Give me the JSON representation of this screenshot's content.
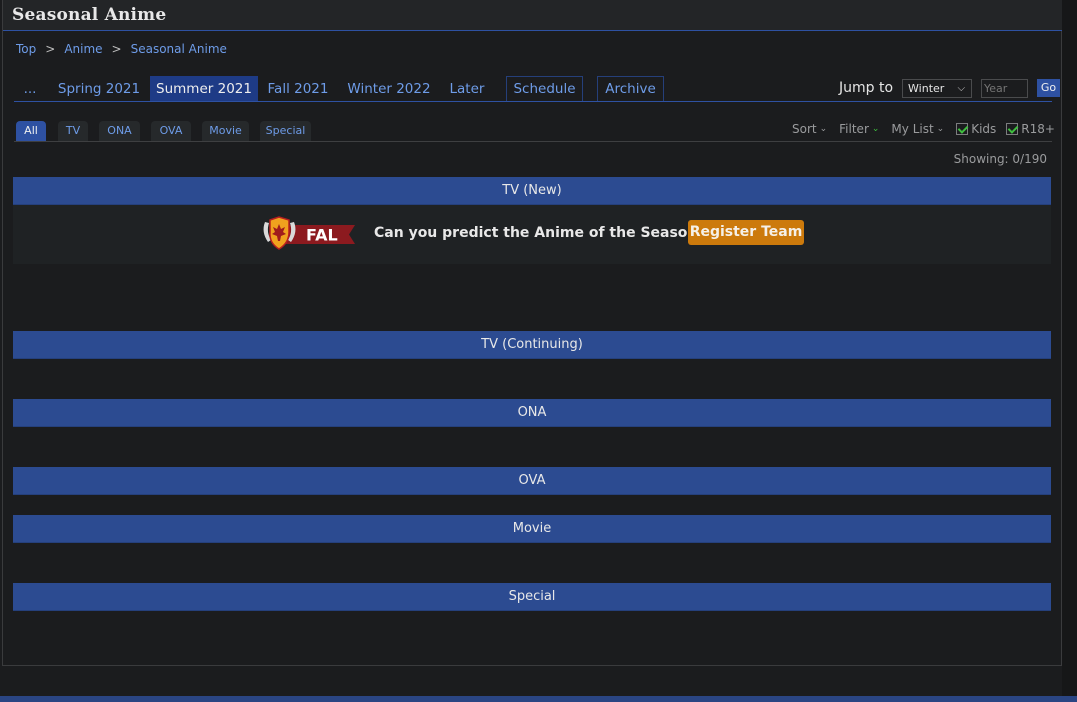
{
  "header": {
    "title": "Seasonal Anime"
  },
  "breadcrumb": {
    "items": [
      "Top",
      "Anime",
      "Seasonal Anime"
    ],
    "separator": ">"
  },
  "season_tabs": [
    {
      "label": "...",
      "active": false
    },
    {
      "label": "Spring 2021",
      "active": false
    },
    {
      "label": "Summer 2021",
      "active": true
    },
    {
      "label": "Fall 2021",
      "active": false
    },
    {
      "label": "Winter 2022",
      "active": false
    },
    {
      "label": "Later",
      "active": false
    },
    {
      "label": "Schedule",
      "active": false
    },
    {
      "label": "Archive",
      "active": false
    }
  ],
  "jump": {
    "label": "Jump to",
    "season_selected": "Winter",
    "year_placeholder": "Year",
    "go_label": "Go"
  },
  "type_tabs": [
    {
      "label": "All",
      "active": true
    },
    {
      "label": "TV",
      "active": false
    },
    {
      "label": "ONA",
      "active": false
    },
    {
      "label": "OVA",
      "active": false
    },
    {
      "label": "Movie",
      "active": false
    },
    {
      "label": "Special",
      "active": false
    }
  ],
  "filters": {
    "sort": "Sort",
    "filter": "Filter",
    "my_list": "My List",
    "kids": {
      "label": "Kids",
      "checked": true
    },
    "r18": {
      "label": "R18+",
      "checked": true
    }
  },
  "showing": "Showing: 0/190",
  "sections": [
    "TV (New)",
    "TV (Continuing)",
    "ONA",
    "OVA",
    "Movie",
    "Special"
  ],
  "fal": {
    "logo_text": "FAL",
    "prompt": "Can you predict the Anime of the Season?",
    "button": "Register Team"
  },
  "colors": {
    "accent": "#2e51a2",
    "section_bar": "#2c4b91",
    "link": "#6e9ce8",
    "fal_button": "#cc7a0c",
    "check_green": "#3fbf3f"
  }
}
